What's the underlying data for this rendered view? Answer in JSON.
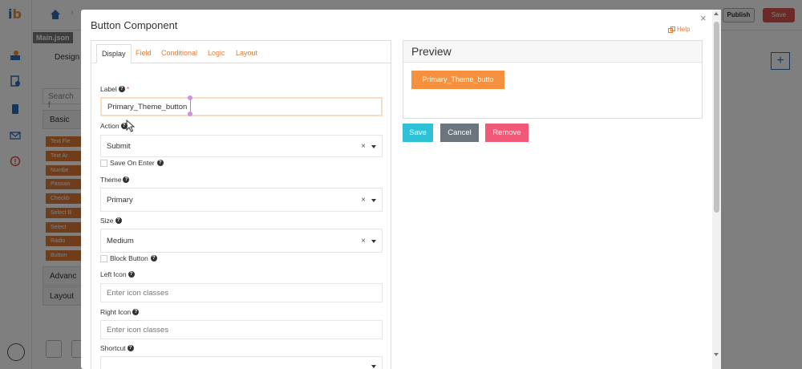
{
  "app": {
    "logo_main": "i",
    "logo_accent": "b",
    "file_tab": "Main.json",
    "design_tab": "Design",
    "publish_label": "Publish",
    "save_label": "Save",
    "search_placeholder": "Search f",
    "basic_group": "Basic",
    "components": [
      "Text Fie",
      "Text Ar",
      "Numbe",
      "Passwo",
      "Checkb",
      "Select B",
      "Select",
      "Radio",
      "Button"
    ],
    "advanced_group": "Advanc",
    "layout_group": "Layout",
    "add_symbol": "+"
  },
  "modal": {
    "title": "Button Component",
    "help_label": "Help",
    "close_symbol": "×",
    "tabs": [
      {
        "label": "Display",
        "active": true
      },
      {
        "label": "Field",
        "active": false
      },
      {
        "label": "Conditional",
        "active": false
      },
      {
        "label": "Logic",
        "active": false
      },
      {
        "label": "Layout",
        "active": false
      }
    ],
    "form": {
      "label_label": "Label",
      "label_required": "*",
      "label_value": "Primary_Theme_button",
      "action_label": "Action",
      "action_value": "Submit",
      "save_on_enter_label": "Save On Enter",
      "theme_label": "Theme",
      "theme_value": "Primary",
      "size_label": "Size",
      "size_value": "Medium",
      "block_button_label": "Block Button",
      "left_icon_label": "Left Icon",
      "left_icon_placeholder": "Enter icon classes",
      "right_icon_label": "Right Icon",
      "right_icon_placeholder": "Enter icon classes",
      "shortcut_label": "Shortcut",
      "clear_symbol": "×",
      "help_symbol": "?"
    },
    "preview": {
      "title": "Preview",
      "button_text": "Primary_Theme_butto"
    },
    "actions": {
      "save": "Save",
      "cancel": "Cancel",
      "remove": "Remove"
    }
  },
  "colors": {
    "accent": "#e07b39",
    "preview_button": "#f5913e",
    "save": "#2fc2d6",
    "cancel": "#6c757d",
    "remove": "#f05a78",
    "top_save": "#d9534f"
  }
}
